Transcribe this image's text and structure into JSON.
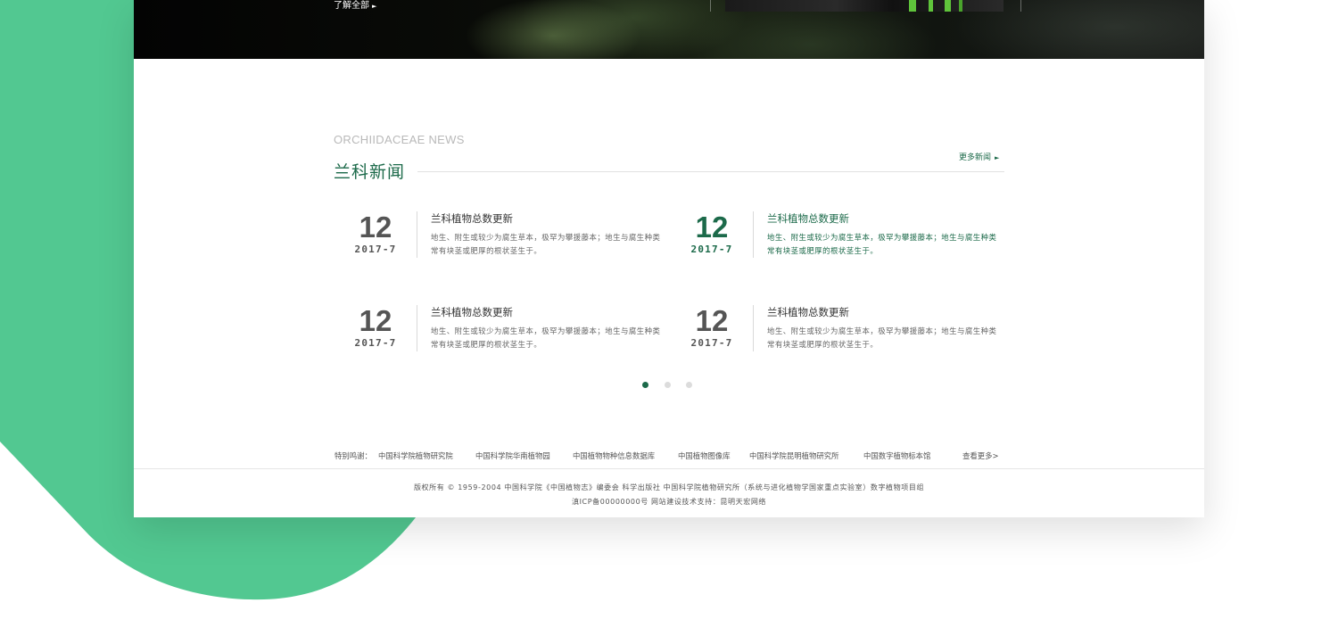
{
  "hero": {
    "learn_more_label": "了解全部",
    "learn_more_arrow": "►"
  },
  "news_section": {
    "title_en": "ORCHIIDACEAE NEWS",
    "title_cn": "兰科新闻",
    "more_label": "更多新闻",
    "more_arrow": "►",
    "items": [
      {
        "day": "12",
        "date": "2017-7",
        "title": "兰科植物总数更新",
        "desc": "地生、附生或较少为腐生草本，极罕为攀援藤本；地生与腐生种类常有块茎或肥厚的根状茎生于。",
        "active": false
      },
      {
        "day": "12",
        "date": "2017-7",
        "title": "兰科植物总数更新",
        "desc": "地生、附生或较少为腐生草本，极罕为攀援藤本；地生与腐生种类常有块茎或肥厚的根状茎生于。",
        "active": true
      },
      {
        "day": "12",
        "date": "2017-7",
        "title": "兰科植物总数更新",
        "desc": "地生、附生或较少为腐生草本，极罕为攀援藤本；地生与腐生种类常有块茎或肥厚的根状茎生于。",
        "active": false
      },
      {
        "day": "12",
        "date": "2017-7",
        "title": "兰科植物总数更新",
        "desc": "地生、附生或较少为腐生草本，极罕为攀援藤本；地生与腐生种类常有块茎或肥厚的根状茎生于。",
        "active": false
      }
    ],
    "pagination": {
      "total": 3,
      "current": 1
    }
  },
  "footer": {
    "thanks_label": "特别鸣谢：",
    "partners": [
      "中国科学院植物研究院",
      "中国科学院华南植物园",
      "中国植物物种信息数据库",
      "中国植物图像库",
      "中国科学院昆明植物研究所",
      "中国数字植物标本馆"
    ],
    "view_more": "查看更多>",
    "copyright": "版权所有  ©  1959-2004  中国科学院《中国植物志》编委会  科学出版社   中国科学院植物研究所（系统与进化植物学国家重点实验室）数字植物项目组",
    "icp": "滇ICP备00000000号  网站建设技术支持：昆明天宏网络"
  },
  "colors": {
    "brand_green": "#1c6a4a",
    "background_accent": "#52c891"
  }
}
